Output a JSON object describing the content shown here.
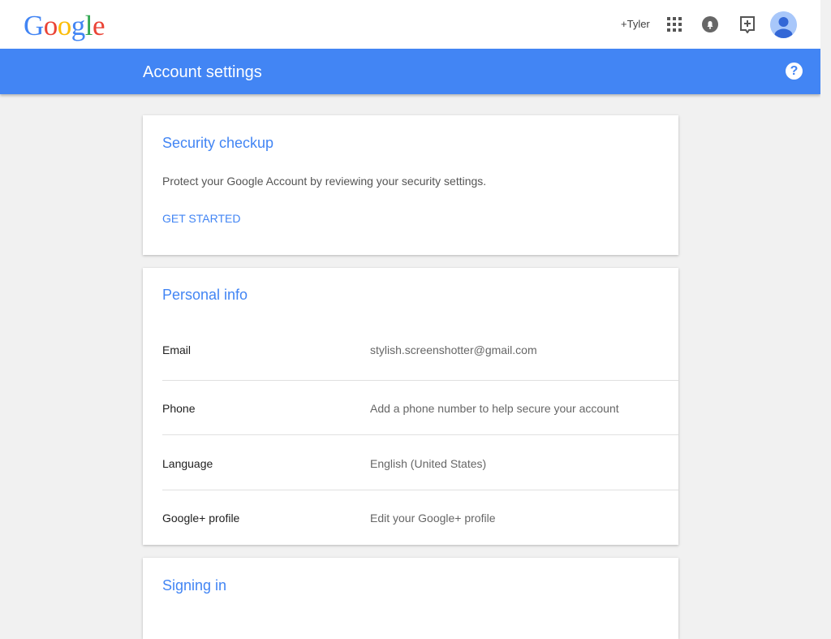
{
  "header": {
    "logo_letters": [
      {
        "char": "G",
        "color": "#4285f4"
      },
      {
        "char": "o",
        "color": "#ea4335"
      },
      {
        "char": "o",
        "color": "#fbbc05"
      },
      {
        "char": "g",
        "color": "#4285f4"
      },
      {
        "char": "l",
        "color": "#34a853"
      },
      {
        "char": "e",
        "color": "#ea4335"
      }
    ],
    "plus_user": "+Tyler",
    "icons": [
      "apps-grid-icon",
      "notifications-icon",
      "share-icon",
      "account-avatar"
    ]
  },
  "title_bar": {
    "title": "Account settings",
    "help_label": "?",
    "color": "#4285f4"
  },
  "security_checkup": {
    "title": "Security checkup",
    "description": "Protect your Google Account by reviewing your security settings.",
    "action": "GET STARTED"
  },
  "personal_info": {
    "title": "Personal info",
    "rows": [
      {
        "label": "Email",
        "value": "stylish.screenshotter@gmail.com"
      },
      {
        "label": "Phone",
        "value": "Add a phone number to help secure your account"
      },
      {
        "label": "Language",
        "value": "English (United States)"
      },
      {
        "label": "Google+ profile",
        "value": "Edit your Google+ profile"
      }
    ]
  },
  "signing_in": {
    "title": "Signing in"
  }
}
